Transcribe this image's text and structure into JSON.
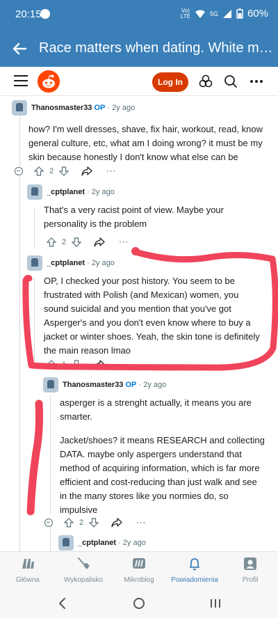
{
  "status_bar": {
    "time": "20:15",
    "network_top": "Vo)",
    "network_bottom": "LTE",
    "signal": "5G",
    "battery": "60%"
  },
  "app_bar": {
    "title": "Race matters when dating. White me..."
  },
  "header": {
    "login_label": "Log In"
  },
  "comments": [
    {
      "author": "Thanosmaster33",
      "op": "OP",
      "meta": "· 2y ago",
      "lines": [
        "how? I'm well dresses, shave, fix hair, workout, read, know",
        "general culture, etc, what am I doing wrong? it must be my",
        "skin because honestly I don't know what else can be"
      ],
      "votes": "2"
    },
    {
      "author": "_cptplanet",
      "op": "",
      "meta": "· 2y ago",
      "lines": [
        "That's a very racist point of view. Maybe your",
        "personality is the problem"
      ],
      "votes": "2"
    },
    {
      "author": "_cptplanet",
      "op": "",
      "meta": "· 2y ago",
      "lines": [
        "OP, I checked your post history. You seem to be",
        "frustrated with Polish (and Mexican) women, you",
        "sound suicidal and you mention that you've got",
        "Asperger's and you don't even know where to buy a",
        "jacket or winter shoes. Yeah, the skin tone is definitely",
        "the main reason lmao"
      ],
      "votes": "1"
    },
    {
      "author": "Thanosmaster33",
      "op": "OP",
      "meta": "· 2y ago",
      "lines": [
        "asperger is a strenght actually, it means you are",
        "smarter.",
        "",
        "Jacket/shoes? it means RESEARCH and collecting",
        "DATA. maybe only aspergers understand that",
        "method of acquiring information, which is far more",
        "efficient and cost-reducing than just walk and see",
        "in the many stores like you normies do, so",
        "impulsive"
      ],
      "votes": "2"
    },
    {
      "author": "_cptplanet",
      "op": "",
      "meta": "· 2y ago",
      "lines": [],
      "votes": ""
    }
  ],
  "more_label": "···",
  "bottom_nav": [
    {
      "label": "Główna",
      "icon": "home-icon"
    },
    {
      "label": "Wykopalisko",
      "icon": "shovel-icon"
    },
    {
      "label": "Mikroblog",
      "icon": "microblog-icon"
    },
    {
      "label": "Powiadomienia",
      "icon": "bell-icon",
      "active": true
    },
    {
      "label": "Profil",
      "icon": "profile-icon"
    }
  ],
  "colors": {
    "app_bar": "#3a7fb8",
    "login": "#d93a00",
    "reddit": "#ff4500",
    "annotation": "#f0445a",
    "op_tag": "#0079d3"
  }
}
